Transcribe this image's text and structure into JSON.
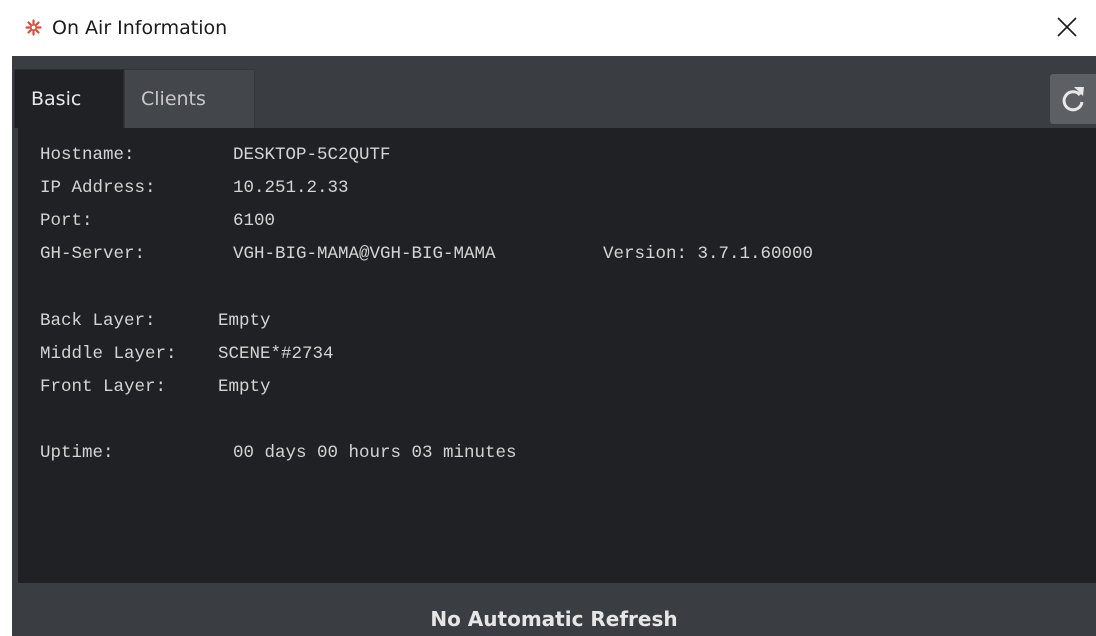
{
  "window": {
    "title": "On Air Information",
    "icon": "asterisk-icon",
    "accent_color": "#e0483a"
  },
  "tabs": [
    {
      "label": "Basic",
      "active": true
    },
    {
      "label": "Clients",
      "active": false
    }
  ],
  "info": {
    "hostname_label": "Hostname:",
    "hostname": "DESKTOP-5C2QUTF",
    "ip_label": "IP Address:",
    "ip": "10.251.2.33",
    "port_label": "Port:",
    "port": "6100",
    "gh_server_label": "GH-Server:",
    "gh_server": "VGH-BIG-MAMA@VGH-BIG-MAMA",
    "version_text": "Version: 3.7.1.60000",
    "back_layer_label": "Back Layer:",
    "back_layer": "Empty",
    "middle_layer_label": "Middle Layer:",
    "middle_layer": "SCENE*#2734",
    "front_layer_label": "Front Layer:",
    "front_layer": "Empty",
    "uptime_label": "Uptime:",
    "uptime": "00 days 00 hours 03 minutes"
  },
  "status": {
    "text": "No Automatic Refresh"
  }
}
